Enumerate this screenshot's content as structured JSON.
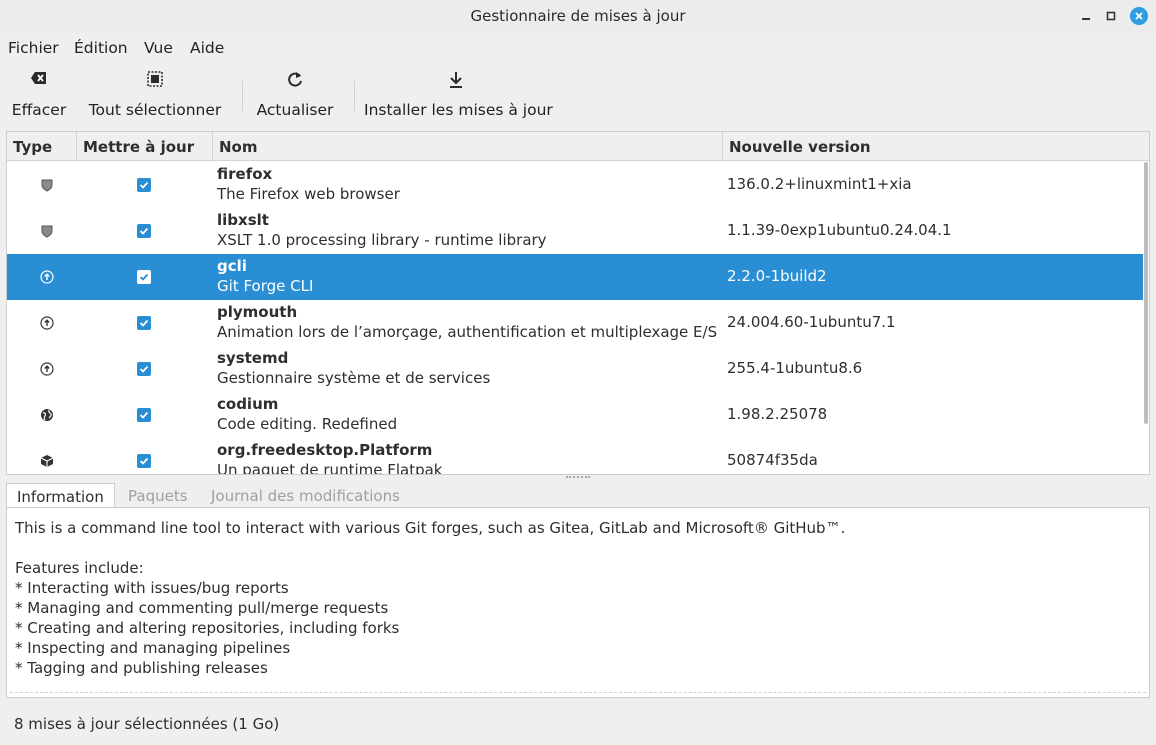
{
  "window": {
    "title": "Gestionnaire de mises à jour",
    "controls": [
      "minimize-icon",
      "maximize-icon",
      "close-icon"
    ]
  },
  "menu": [
    "Fichier",
    "Édition",
    "Vue",
    "Aide"
  ],
  "toolbar": {
    "clear": {
      "label": "Effacer",
      "icon": "clear-icon"
    },
    "select_all": {
      "label": "Tout sélectionner",
      "icon": "select-all-icon"
    },
    "refresh": {
      "label": "Actualiser",
      "icon": "refresh-icon"
    },
    "install": {
      "label": "Installer les mises à jour",
      "icon": "download-icon"
    }
  },
  "columns": [
    "Type",
    "Mettre à jour",
    "Nom",
    "Nouvelle version"
  ],
  "updates": [
    {
      "type": "security-shield-icon",
      "checked": true,
      "name": "firefox",
      "description": "The Firefox web browser",
      "version": "136.0.2+linuxmint1+xia"
    },
    {
      "type": "security-shield-icon",
      "checked": true,
      "name": "libxslt",
      "description": "XSLT 1.0 processing library - runtime library",
      "version": "1.1.39-0exp1ubuntu0.24.04.1"
    },
    {
      "type": "upgrade-arrow-icon",
      "checked": true,
      "name": "gcli",
      "description": "Git Forge CLI",
      "version": "2.2.0-1build2",
      "selected": true
    },
    {
      "type": "upgrade-arrow-icon",
      "checked": true,
      "name": "plymouth",
      "description": "Animation lors de l’amorçage, authentification et multiplexage E/S",
      "version": "24.004.60-1ubuntu7.1"
    },
    {
      "type": "upgrade-arrow-icon",
      "checked": true,
      "name": "systemd",
      "description": "Gestionnaire système et de services",
      "version": "255.4-1ubuntu8.6"
    },
    {
      "type": "globe-icon",
      "checked": true,
      "name": "codium",
      "description": "Code editing. Redefined",
      "version": "1.98.2.25078"
    },
    {
      "type": "package-box-icon",
      "checked": true,
      "name": "org.freedesktop.Platform",
      "description": "Un paquet de runtime Flatpak",
      "version": "50874f35da"
    }
  ],
  "tabs": [
    "Information",
    "Paquets",
    "Journal des modifications"
  ],
  "active_tab": "Information",
  "info_text": {
    "intro": "This is a command line tool to interact with various Git forges, such as Gitea, GitLab and Microsoft® GitHub™.",
    "features_heading": "Features include:",
    "features": [
      "* Interacting with issues/bug reports",
      "* Managing and commenting pull/merge requests",
      "* Creating and altering repositories, including forks",
      "* Inspecting and managing pipelines",
      "* Tagging and publishing releases"
    ]
  },
  "status": "8 mises à jour sélectionnées (1 Go)",
  "colors": {
    "accent": "#2a8ed4",
    "close": "#2d9fe0"
  }
}
